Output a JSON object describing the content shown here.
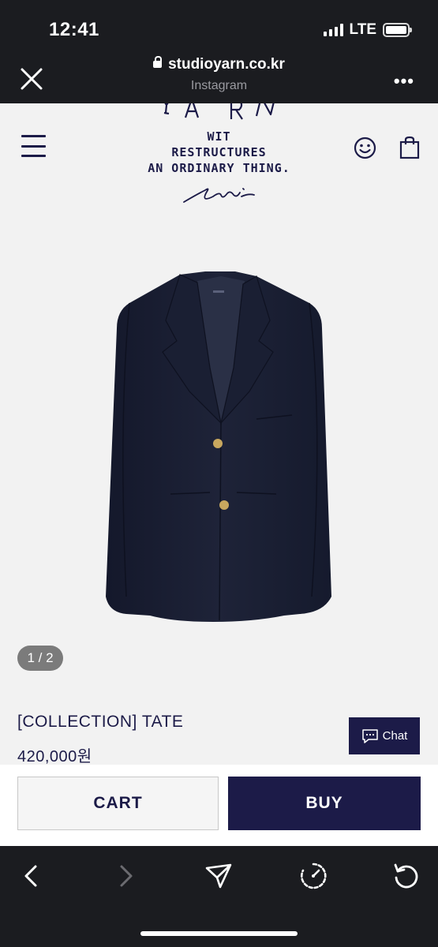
{
  "status_bar": {
    "time": "12:41",
    "network": "LTE"
  },
  "browser": {
    "url": "studioyarn.co.kr",
    "source": "Instagram"
  },
  "site": {
    "logo_text": "YARN",
    "tagline": [
      "WIT",
      "RESTRUCTURES",
      "AN ORDINARY THING."
    ]
  },
  "product": {
    "image_pager": "1 / 2",
    "title": "[COLLECTION] TATE",
    "price": "420,000원"
  },
  "chat": {
    "label": "Chat"
  },
  "actions": {
    "cart_label": "CART",
    "buy_label": "BUY"
  },
  "icons": {
    "close": "close-icon",
    "more": "more-icon",
    "menu": "hamburger-menu-icon",
    "account": "smiley-icon",
    "cart": "shopping-bag-icon",
    "chat": "chat-bubble-icon",
    "back": "chevron-left-icon",
    "forward": "chevron-right-icon",
    "share": "share-icon",
    "speed": "speedometer-icon",
    "reload": "reload-icon"
  },
  "colors": {
    "brand": "#1c1b48",
    "page_bg": "#f2f2f2",
    "chrome_bg": "#1b1c20"
  }
}
